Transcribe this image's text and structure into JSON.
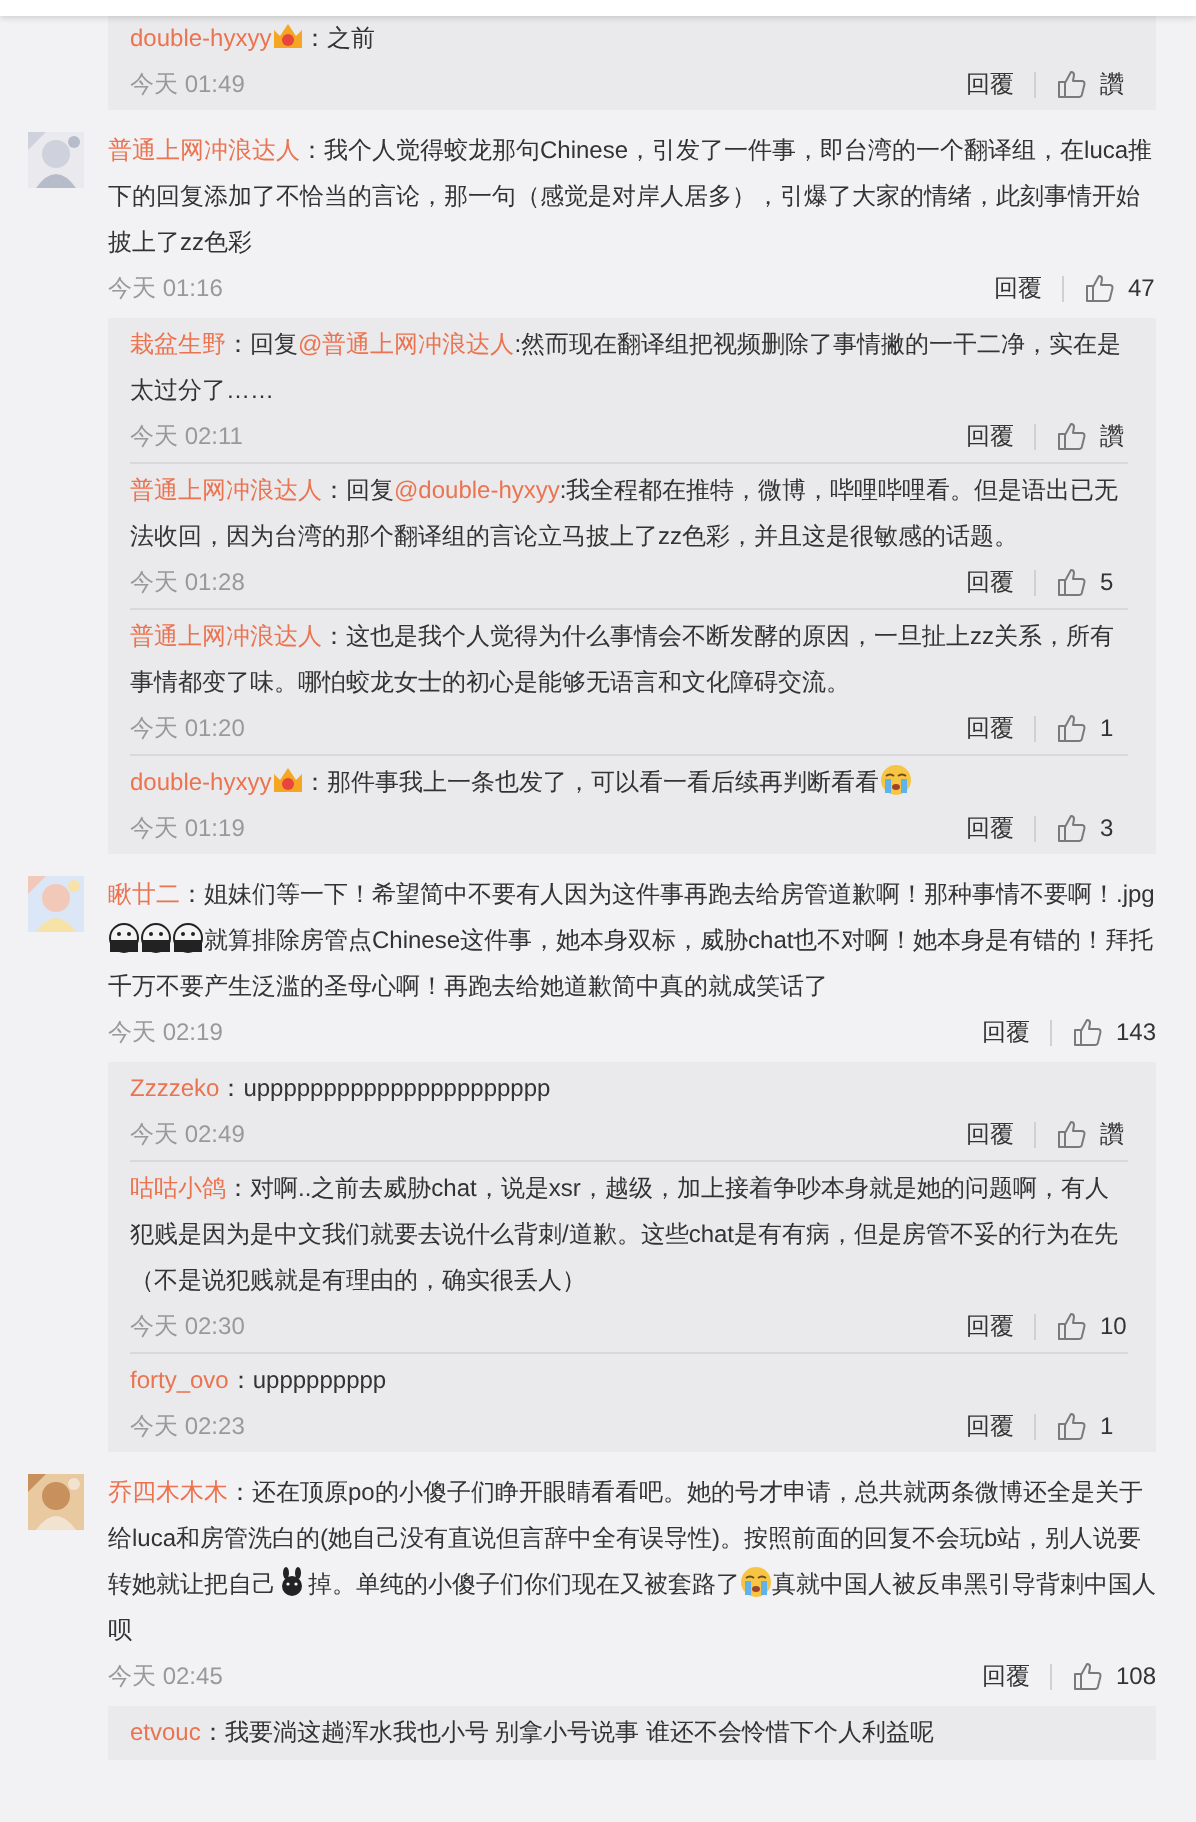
{
  "leading_replies": [
    {
      "user": "double-hyxyy",
      "vip": true,
      "body": [
        {
          "kind": "text",
          "text": "：之前"
        }
      ],
      "time": "今天 01:49",
      "reply": "回覆",
      "likes": "讚"
    }
  ],
  "comments": [
    {
      "user": "普通上网冲浪达人",
      "vip": false,
      "body": [
        {
          "kind": "text",
          "text": "：我个人觉得蛟龙那句Chinese，引发了一件事，即台湾的一个翻译组，在luca推下的回复添加了不恰当的言论，那一句（感觉是对岸人居多），引爆了大家的情绪，此刻事情开始披上了zz色彩"
        }
      ],
      "time": "今天 01:16",
      "reply": "回覆",
      "likes": "47",
      "replies": [
        {
          "user": "栽盆生野",
          "vip": false,
          "body": [
            {
              "kind": "text",
              "text": "：回复"
            },
            {
              "kind": "mention",
              "text": "@普通上网冲浪达人"
            },
            {
              "kind": "text",
              "text": ":然而现在翻译组把视频删除了事情撇的一干二净，实在是太过分了……"
            }
          ],
          "time": "今天 02:11",
          "reply": "回覆",
          "likes": "讚"
        },
        {
          "user": "普通上网冲浪达人",
          "vip": false,
          "body": [
            {
              "kind": "text",
              "text": "：回复"
            },
            {
              "kind": "mention",
              "text": "@double-hyxyy"
            },
            {
              "kind": "text",
              "text": ":我全程都在推特，微博，哔哩哔哩看。但是语出已无法收回，因为台湾的那个翻译组的言论立马披上了zz色彩，并且这是很敏感的话题。"
            }
          ],
          "time": "今天 01:28",
          "reply": "回覆",
          "likes": "5"
        },
        {
          "user": "普通上网冲浪达人",
          "vip": false,
          "body": [
            {
              "kind": "text",
              "text": "：这也是我个人觉得为什么事情会不断发酵的原因，一旦扯上zz关系，所有事情都变了味。哪怕蛟龙女士的初心是能够无语言和文化障碍交流。"
            }
          ],
          "time": "今天 01:20",
          "reply": "回覆",
          "likes": "1"
        },
        {
          "user": "double-hyxyy",
          "vip": true,
          "body": [
            {
              "kind": "text",
              "text": "：那件事我上一条也发了，可以看一看后续再判断看看"
            },
            {
              "kind": "cry-emoji"
            }
          ],
          "time": "今天 01:19",
          "reply": "回覆",
          "likes": "3"
        }
      ]
    },
    {
      "user": "瞅廿二",
      "vip": false,
      "body": [
        {
          "kind": "text",
          "text": "：姐妹们等一下！希望简中不要有人因为这件事再跑去给房管道歉啊！那种事情不要啊！.jpg"
        },
        {
          "kind": "shock-emoji"
        },
        {
          "kind": "shock-emoji"
        },
        {
          "kind": "shock-emoji"
        },
        {
          "kind": "text",
          "text": "就算排除房管点Chinese这件事，她本身双标，威胁chat也不对啊！她本身是有错的！拜托千万不要产生泛滥的圣母心啊！再跑去给她道歉简中真的就成笑话了"
        }
      ],
      "time": "今天 02:19",
      "reply": "回覆",
      "likes": "143",
      "replies": [
        {
          "user": "Zzzzeko",
          "vip": false,
          "body": [
            {
              "kind": "text",
              "text": "：upppppppppppppppppppppp"
            }
          ],
          "time": "今天 02:49",
          "reply": "回覆",
          "likes": "讚"
        },
        {
          "user": "咕咕小鸽",
          "vip": false,
          "body": [
            {
              "kind": "text",
              "text": "：对啊..之前去威胁chat，说是xsr，越级，加上接着争吵本身就是她的问题啊，有人犯贱是因为是中文我们就要去说什么背刺/道歉。这些chat是有有病，但是房管不妥的行为在先（不是说犯贱就是有理由的，确实很丢人）"
            }
          ],
          "time": "今天 02:30",
          "reply": "回覆",
          "likes": "10"
        },
        {
          "user": "forty_ovo",
          "vip": false,
          "body": [
            {
              "kind": "text",
              "text": "：uppppppppp"
            }
          ],
          "time": "今天 02:23",
          "reply": "回覆",
          "likes": "1"
        }
      ]
    },
    {
      "user": "乔四木木木",
      "vip": false,
      "body": [
        {
          "kind": "text",
          "text": "：还在顶原po的小傻子们睁开眼睛看看吧。她的号才申请，总共就两条微博还全是关于给luca和房管洗白的(她自己没有直说但言辞中全有误导性)。按照前面的回复不会玩b站，别人说要转她就让把自己"
        },
        {
          "kind": "animal-emoji"
        },
        {
          "kind": "text",
          "text": "掉。单纯的小傻子们你们现在又被套路了"
        },
        {
          "kind": "cry-emoji"
        },
        {
          "kind": "text",
          "text": "真就中国人被反串黑引导背刺中国人呗"
        }
      ],
      "time": "今天 02:45",
      "reply": "回覆",
      "likes": "108",
      "replies": [
        {
          "user": "etvouc",
          "vip": false,
          "body": [
            {
              "kind": "text",
              "text": "：我要淌这趟浑水我也小号 别拿小号说事 谁还不会怜惜下个人利益呢"
            }
          ]
        }
      ]
    }
  ]
}
